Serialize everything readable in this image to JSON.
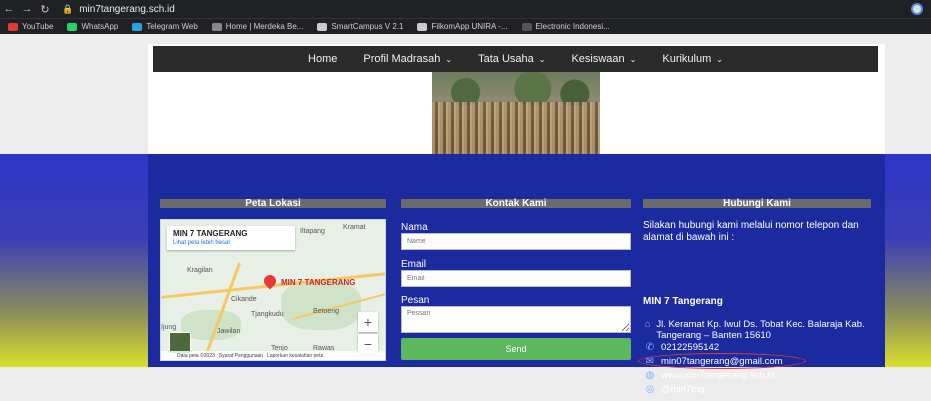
{
  "browser": {
    "url": "min7tangerang.sch.id",
    "bookmarks": [
      {
        "label": "YouTube",
        "color": "#e53935"
      },
      {
        "label": "WhatsApp",
        "color": "#25d366"
      },
      {
        "label": "Telegram Web",
        "color": "#2aa3e0"
      },
      {
        "label": "Home | Merdeka Be...",
        "color": "#888888"
      },
      {
        "label": "SmartCampus V 2.1",
        "color": "#cccccc"
      },
      {
        "label": "FilkomApp UNIRA -...",
        "color": "#cccccc"
      },
      {
        "label": "Electronic Indonesi...",
        "color": "#555555"
      }
    ]
  },
  "nav": {
    "items": [
      {
        "label": "Home",
        "has_menu": false
      },
      {
        "label": "Profil Madrasah",
        "has_menu": true
      },
      {
        "label": "Tata Usaha",
        "has_menu": true
      },
      {
        "label": "Kesiswaan",
        "has_menu": true
      },
      {
        "label": "Kurikulum",
        "has_menu": true
      }
    ]
  },
  "carousel": {
    "dot_count": 16,
    "active_index": 3
  },
  "footer": {
    "map_title": "Peta Lokasi",
    "contact_title": "Kontak Kami",
    "reach_title": "Hubungi Kami",
    "map": {
      "place_name": "MIN 7 TANGERANG",
      "link": "Lihat peta lebih besar",
      "pin_label": "MIN 7 TANGERANG",
      "labels": [
        "Kragilan",
        "Cikande",
        "Tjangkudu",
        "Betoeng",
        "Kramat",
        "Jawilan",
        "Tenjo",
        "Rawas",
        "Ijung",
        "Iltapang"
      ],
      "footer_items": [
        "Data peta ©2023",
        "Syarat Penggunaan",
        "Laporkan kesalahan peta"
      ]
    },
    "form": {
      "name_label": "Nama",
      "name_placeholder": "Name",
      "email_label": "Email",
      "email_placeholder": "Email",
      "message_label": "Pesan",
      "message_placeholder": "Pessan",
      "send_label": "Send"
    },
    "reach": {
      "intro": "Silakan hubungi kami melalui nomor telepon dan alamat di bawah ini :",
      "school": "MIN 7 Tangerang",
      "address": "Jl. Keramat Kp. Iwul Ds. Tobat Kec. Balaraja Kab. Tangerang – Banten 15610",
      "phone": "02122595142",
      "email": "min07tangerang@gmail.com",
      "website": "www.min7tangerang.sch.id",
      "instagram": "@min7tng"
    }
  }
}
